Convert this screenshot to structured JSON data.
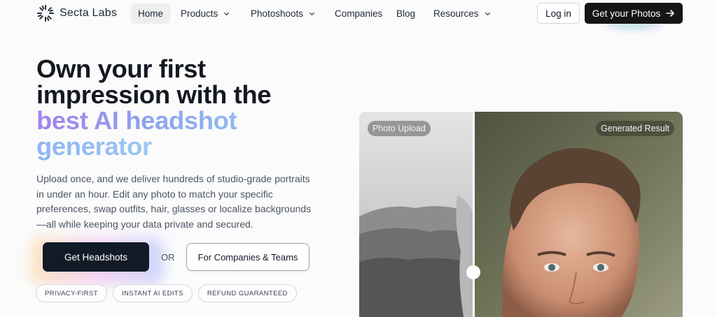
{
  "nav": {
    "brand": "Secta Labs",
    "items": [
      {
        "label": "Home",
        "active": true,
        "dropdown": false
      },
      {
        "label": "Products",
        "active": false,
        "dropdown": true
      },
      {
        "label": "Photoshoots",
        "active": false,
        "dropdown": true
      },
      {
        "label": "Companies",
        "active": false,
        "dropdown": false
      },
      {
        "label": "Blog",
        "active": false,
        "dropdown": false
      },
      {
        "label": "Resources",
        "active": false,
        "dropdown": true
      }
    ],
    "login_label": "Log in",
    "cta_label": "Get your Photos"
  },
  "hero": {
    "headline_line1": "Own your first",
    "headline_line2": "impression with the",
    "headline_line3": "best AI headshot",
    "headline_line4": "generator",
    "description": "Upload once, and we deliver hundreds of studio-grade portraits in under an hour. Edit any photo to match your specific preferences, swap outfits, hair, glasses or localize backgrounds —all while keeping your data private and secured.",
    "primary_button": "Get Headshots",
    "or_text": "OR",
    "secondary_button": "For Companies & Teams",
    "badges": [
      "PRIVACY-FIRST",
      "INSTANT AI EDITS",
      "REFUND GUARANTEED"
    ]
  },
  "comparison": {
    "left_label": "Photo Upload",
    "right_label": "Generated Result"
  },
  "colors": {
    "cta_dark": "#151515",
    "primary_dark": "#121a27",
    "gradient_purple": "#a383ee",
    "gradient_blue": "#8fb9f2"
  }
}
